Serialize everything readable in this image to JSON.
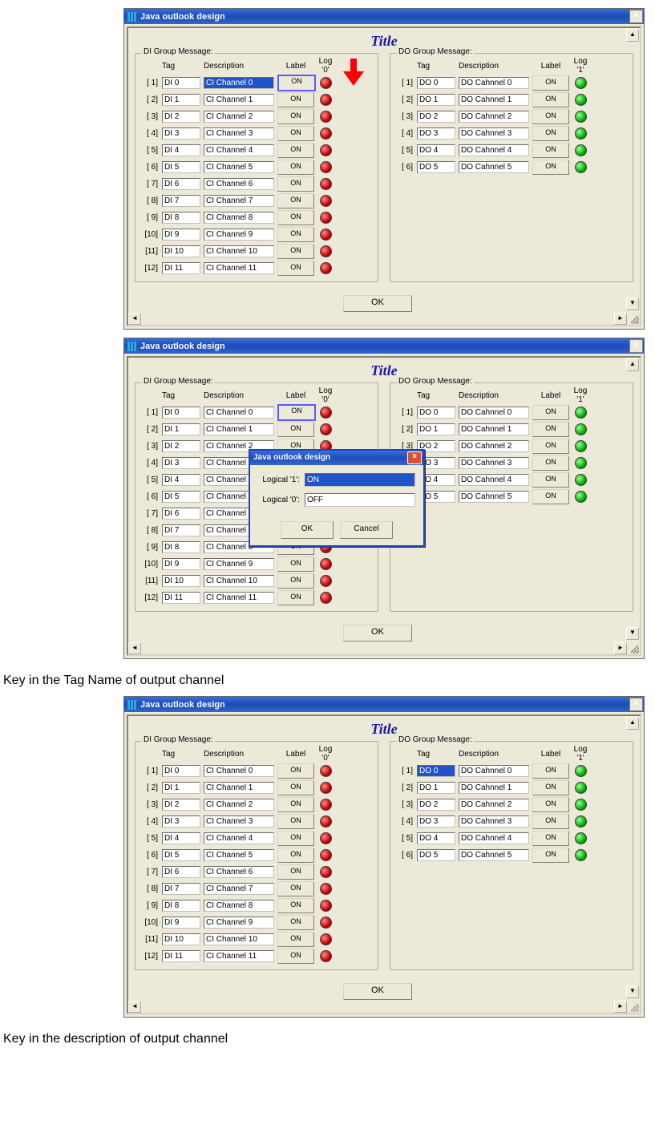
{
  "window_title": "Java outlook design",
  "inner_title": "Title",
  "ok_label": "OK",
  "close_glyph": "×",
  "di_group": {
    "legend": "DI Group Message:",
    "headers": {
      "tag": "Tag",
      "desc": "Description",
      "label": "Label",
      "log": "Log '0'"
    },
    "rows": [
      {
        "idx": "[ 1]",
        "tag": "DI 0",
        "desc": "CI Channel 0",
        "label": "ON",
        "led": "red"
      },
      {
        "idx": "[ 2]",
        "tag": "DI 1",
        "desc": "CI Channel 1",
        "label": "ON",
        "led": "red"
      },
      {
        "idx": "[ 3]",
        "tag": "DI 2",
        "desc": "CI Channel 2",
        "label": "ON",
        "led": "red"
      },
      {
        "idx": "[ 4]",
        "tag": "DI 3",
        "desc": "CI Channel 3",
        "label": "ON",
        "led": "red"
      },
      {
        "idx": "[ 5]",
        "tag": "DI 4",
        "desc": "CI Channel 4",
        "label": "ON",
        "led": "red"
      },
      {
        "idx": "[ 6]",
        "tag": "DI 5",
        "desc": "CI Channel 5",
        "label": "ON",
        "led": "red"
      },
      {
        "idx": "[ 7]",
        "tag": "DI 6",
        "desc": "CI Channel 6",
        "label": "ON",
        "led": "red"
      },
      {
        "idx": "[ 8]",
        "tag": "DI 7",
        "desc": "CI Channel 7",
        "label": "ON",
        "led": "red"
      },
      {
        "idx": "[ 9]",
        "tag": "DI 8",
        "desc": "CI Channel 8",
        "label": "ON",
        "led": "red"
      },
      {
        "idx": "[10]",
        "tag": "DI 9",
        "desc": "CI Channel 9",
        "label": "ON",
        "led": "red"
      },
      {
        "idx": "[11]",
        "tag": "DI 10",
        "desc": "CI Channel 10",
        "label": "ON",
        "led": "red"
      },
      {
        "idx": "[12]",
        "tag": "DI 11",
        "desc": "CI Channel 11",
        "label": "ON",
        "led": "red"
      }
    ]
  },
  "do_group": {
    "legend": "DO Group Message:",
    "headers": {
      "tag": "Tag",
      "desc": "Description",
      "label": "Label",
      "log": "Log '1'"
    },
    "rows": [
      {
        "idx": "[ 1]",
        "tag": "DO 0",
        "desc": "DO Cahnnel 0",
        "label": "ON",
        "led": "green"
      },
      {
        "idx": "[ 2]",
        "tag": "DO 1",
        "desc": "DO Cahnnel 1",
        "label": "ON",
        "led": "green"
      },
      {
        "idx": "[ 3]",
        "tag": "DO 2",
        "desc": "DO Cahnnel 2",
        "label": "ON",
        "led": "green"
      },
      {
        "idx": "[ 4]",
        "tag": "DO 3",
        "desc": "DO Cahnnel 3",
        "label": "ON",
        "led": "green"
      },
      {
        "idx": "[ 5]",
        "tag": "DO 4",
        "desc": "DO Cahnnel 4",
        "label": "ON",
        "led": "green"
      },
      {
        "idx": "[ 6]",
        "tag": "DO 5",
        "desc": "DO Cahnnel 5",
        "label": "ON",
        "led": "green"
      }
    ]
  },
  "dialog": {
    "title": "Java outlook design",
    "row1_label": "Logical '1':",
    "row1_value": "ON",
    "row2_label": "Logical '0':",
    "row2_value": "OFF",
    "ok": "OK",
    "cancel": "Cancel"
  },
  "caption1": "Key in the Tag Name of output channel",
  "caption2": "Key in the description of output channel",
  "scroll": {
    "up": "▲",
    "down": "▼",
    "left": "◄",
    "right": "►"
  }
}
